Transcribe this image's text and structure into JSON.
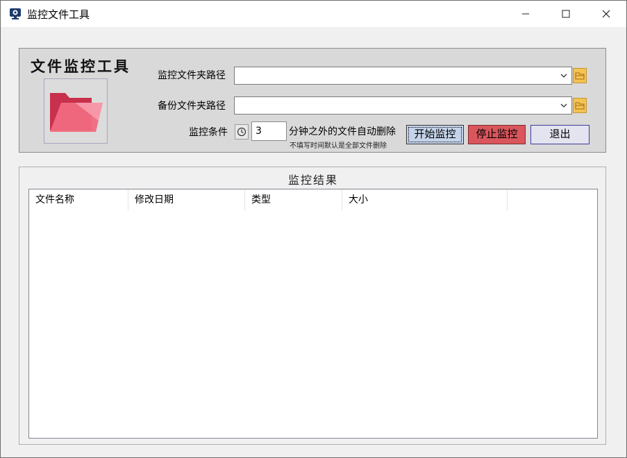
{
  "window": {
    "title": "监控文件工具",
    "minimize_glyph": "—",
    "maximize_glyph": "☐",
    "close_glyph": "✕"
  },
  "brand": {
    "title": "文件监控工具",
    "icon": "folder-icon"
  },
  "form": {
    "monitor_path": {
      "label": "监控文件夹路径",
      "value": ""
    },
    "backup_path": {
      "label": "备份文件夹路径",
      "value": ""
    },
    "condition": {
      "label": "监控条件",
      "minutes": "3",
      "suffix": "分钟之外的文件自动删除",
      "hint": "不填写时间默认是全部文件删除"
    }
  },
  "buttons": {
    "start": "开始监控",
    "stop": "停止监控",
    "exit": "退出"
  },
  "results": {
    "title": "监控结果",
    "columns": [
      "文件名称",
      "修改日期",
      "类型",
      "大小"
    ],
    "rows": []
  },
  "colors": {
    "stop_button": "#d9565c",
    "start_button": "#c5d3ea",
    "browse_button": "#f4c452",
    "folder": "#e0506a"
  }
}
